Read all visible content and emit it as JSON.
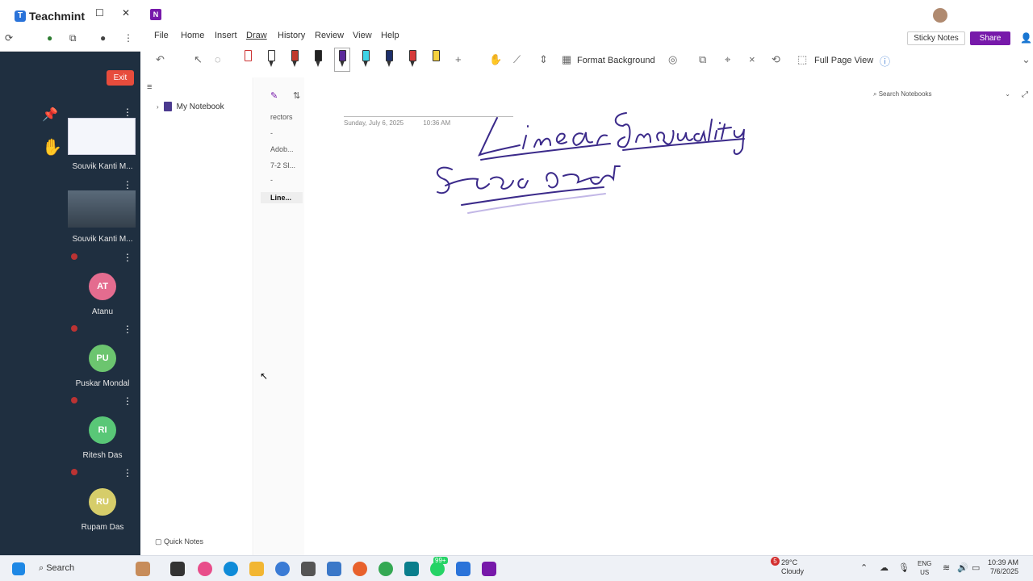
{
  "teachmint": {
    "brand": "Teachmint",
    "exit_label": "Exit",
    "participants": [
      {
        "name": "Souvik Kanti M...",
        "type": "screen"
      },
      {
        "name": "Souvik Kanti M...",
        "type": "video"
      },
      {
        "name": "Atanu",
        "initials": "AT",
        "color": "#e46c8f"
      },
      {
        "name": "Puskar Mondal",
        "initials": "PU",
        "color": "#6cc56f"
      },
      {
        "name": "Ritesh Das",
        "initials": "RI",
        "color": "#59c777"
      },
      {
        "name": "Rupam Das",
        "initials": "RU",
        "color": "#d6cd6a"
      }
    ]
  },
  "onenote": {
    "menu": [
      "File",
      "Home",
      "Insert",
      "Draw",
      "History",
      "Review",
      "View",
      "Help"
    ],
    "active_menu": "Draw",
    "sticky_notes": "Sticky Notes",
    "share": "Share",
    "format_background": "Format Background",
    "full_page_view": "Full Page View",
    "notebook": "My Notebook",
    "quick_notes": "Quick Notes",
    "pages": [
      "rectors",
      "-",
      "Adob...",
      "7-2 Sl...",
      "-",
      "Line..."
    ],
    "active_page": "Line...",
    "page_date": "Sunday, July 6, 2025",
    "page_time": "10:36 AM",
    "search_placeholder": "Search Notebooks",
    "ink_color": "#3b2a8a"
  },
  "taskbar": {
    "search": "Search",
    "temperature": "29°C",
    "weather": "Cloudy",
    "badge": "5",
    "lang1": "ENG",
    "lang2": "US",
    "time": "10:39 AM",
    "date": "7/6/2025",
    "chrome_badge": "99+"
  }
}
